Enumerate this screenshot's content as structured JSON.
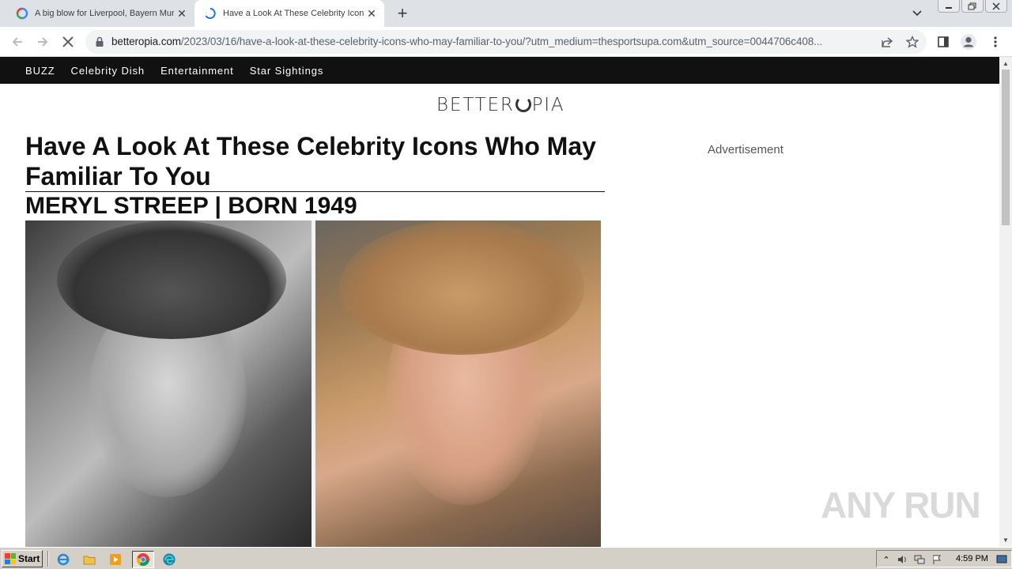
{
  "browser": {
    "tabs": [
      {
        "title": "A big blow for Liverpool, Bayern Munich",
        "active": false
      },
      {
        "title": "Have a Look At These Celebrity Icons",
        "active": true
      }
    ],
    "url_host": "betteropia.com",
    "url_path": "/2023/03/16/have-a-look-at-these-celebrity-icons-who-may-familiar-to-you/?utm_medium=thesportsupa.com&utm_source=0044706c408..."
  },
  "site": {
    "nav": [
      "BUZZ",
      "Celebrity Dish",
      "Entertainment",
      "Star Sightings"
    ],
    "logo_pre": "BETTER",
    "logo_post": "PIA"
  },
  "article": {
    "headline": "Have A Look At These Celebrity Icons Who May Familiar To You",
    "subhead": "MERYL STREEP | BORN 1949"
  },
  "sidebar": {
    "ad_label": "Advertisement"
  },
  "watermark": "ANY RUN",
  "taskbar": {
    "start_label": "Start",
    "clock": "4:59 PM"
  },
  "colors": {
    "site_nav_bg": "#111111",
    "tabstrip_bg": "#dee1e6",
    "taskbar_bg": "#d4d0c8"
  }
}
